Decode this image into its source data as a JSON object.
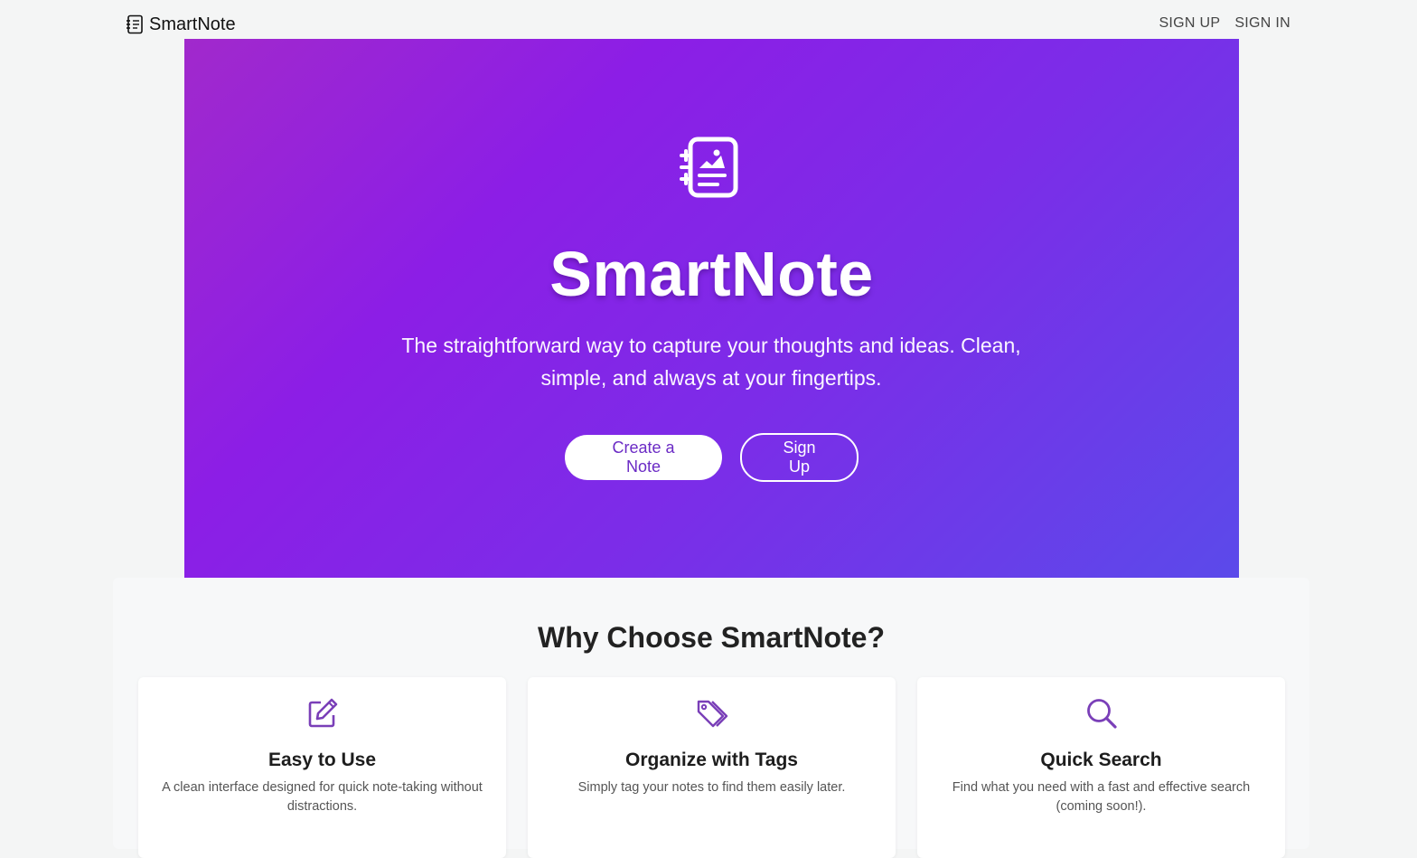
{
  "header": {
    "brand_name": "SmartNote",
    "brand_icon": "notebook-icon",
    "nav": {
      "sign_up": "SIGN UP",
      "sign_in": "SIGN IN"
    }
  },
  "hero": {
    "icon": "notebook-icon",
    "title": "SmartNote",
    "subtitle": "The straightforward way to capture your thoughts and ideas. Clean, simple, and always at your fingertips.",
    "primary_button": "Create a Note",
    "secondary_button": "Sign Up",
    "gradient_colors": [
      "#a129cc",
      "#8c1ee6",
      "#5b4aea"
    ]
  },
  "features": {
    "title": "Why Choose SmartNote?",
    "accent_color": "#7a3fb8",
    "items": [
      {
        "icon": "edit-icon",
        "title": "Easy to Use",
        "text": "A clean interface designed for quick note-taking without distractions."
      },
      {
        "icon": "tag-icon",
        "title": "Organize with Tags",
        "text": "Simply tag your notes to find them easily later."
      },
      {
        "icon": "search-icon",
        "title": "Quick Search",
        "text": "Find what you need with a fast and effective search (coming soon!)."
      }
    ]
  }
}
